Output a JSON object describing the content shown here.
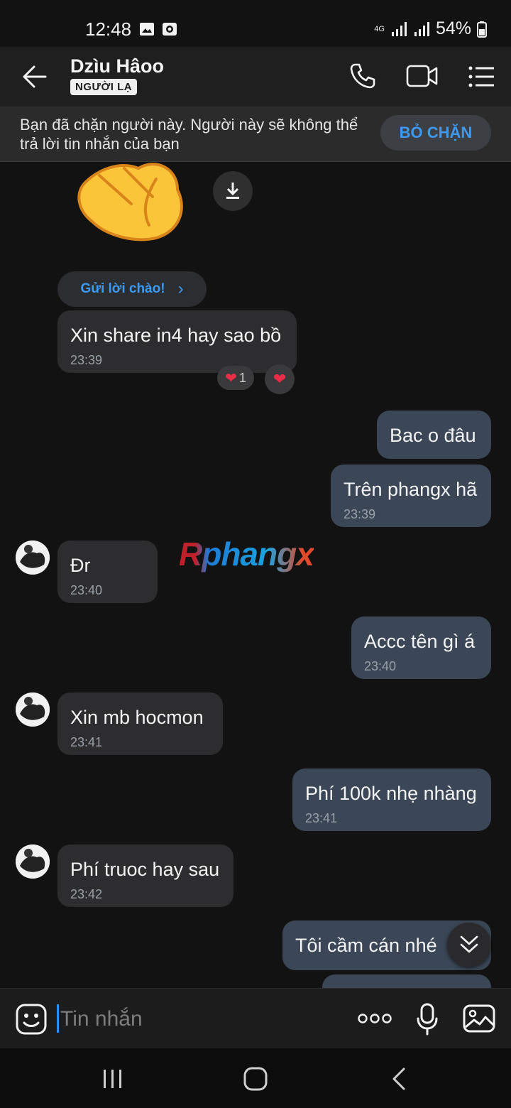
{
  "status_bar": {
    "time": "12:48",
    "network": "4G",
    "battery": "54%"
  },
  "header": {
    "contact_name": "Dzìu Hâoo",
    "badge": "NGƯỜI LẠ"
  },
  "banner": {
    "text": "Bạn đã chặn người này. Người này sẽ không thể trả lời tin nhắn của bạn",
    "button": "BỎ CHẶN"
  },
  "greeting_chip": {
    "label": "Gửi lời chào!",
    "arrow": "›"
  },
  "watermark": {
    "text": "Rphangx"
  },
  "reactions": {
    "count": "1"
  },
  "messages": [
    {
      "text": "Xin share in4 hay sao bồ",
      "time": "23:39"
    },
    {
      "text": "Bac o đâu",
      "time": ""
    },
    {
      "text": "Trên phangx hã",
      "time": "23:39"
    },
    {
      "text": "Đr",
      "time": "23:40"
    },
    {
      "text": "Accc tên gì á",
      "time": "23:40"
    },
    {
      "text": "Xin mb hocmon",
      "time": "23:41"
    },
    {
      "text": "Phí 100k nhẹ nhàng",
      "time": "23:41"
    },
    {
      "text": "Phí truoc hay sau",
      "time": "23:42"
    },
    {
      "text": "Tôi cầm cán nhé",
      "time": ""
    }
  ],
  "composer": {
    "placeholder": "Tin nhắn"
  }
}
